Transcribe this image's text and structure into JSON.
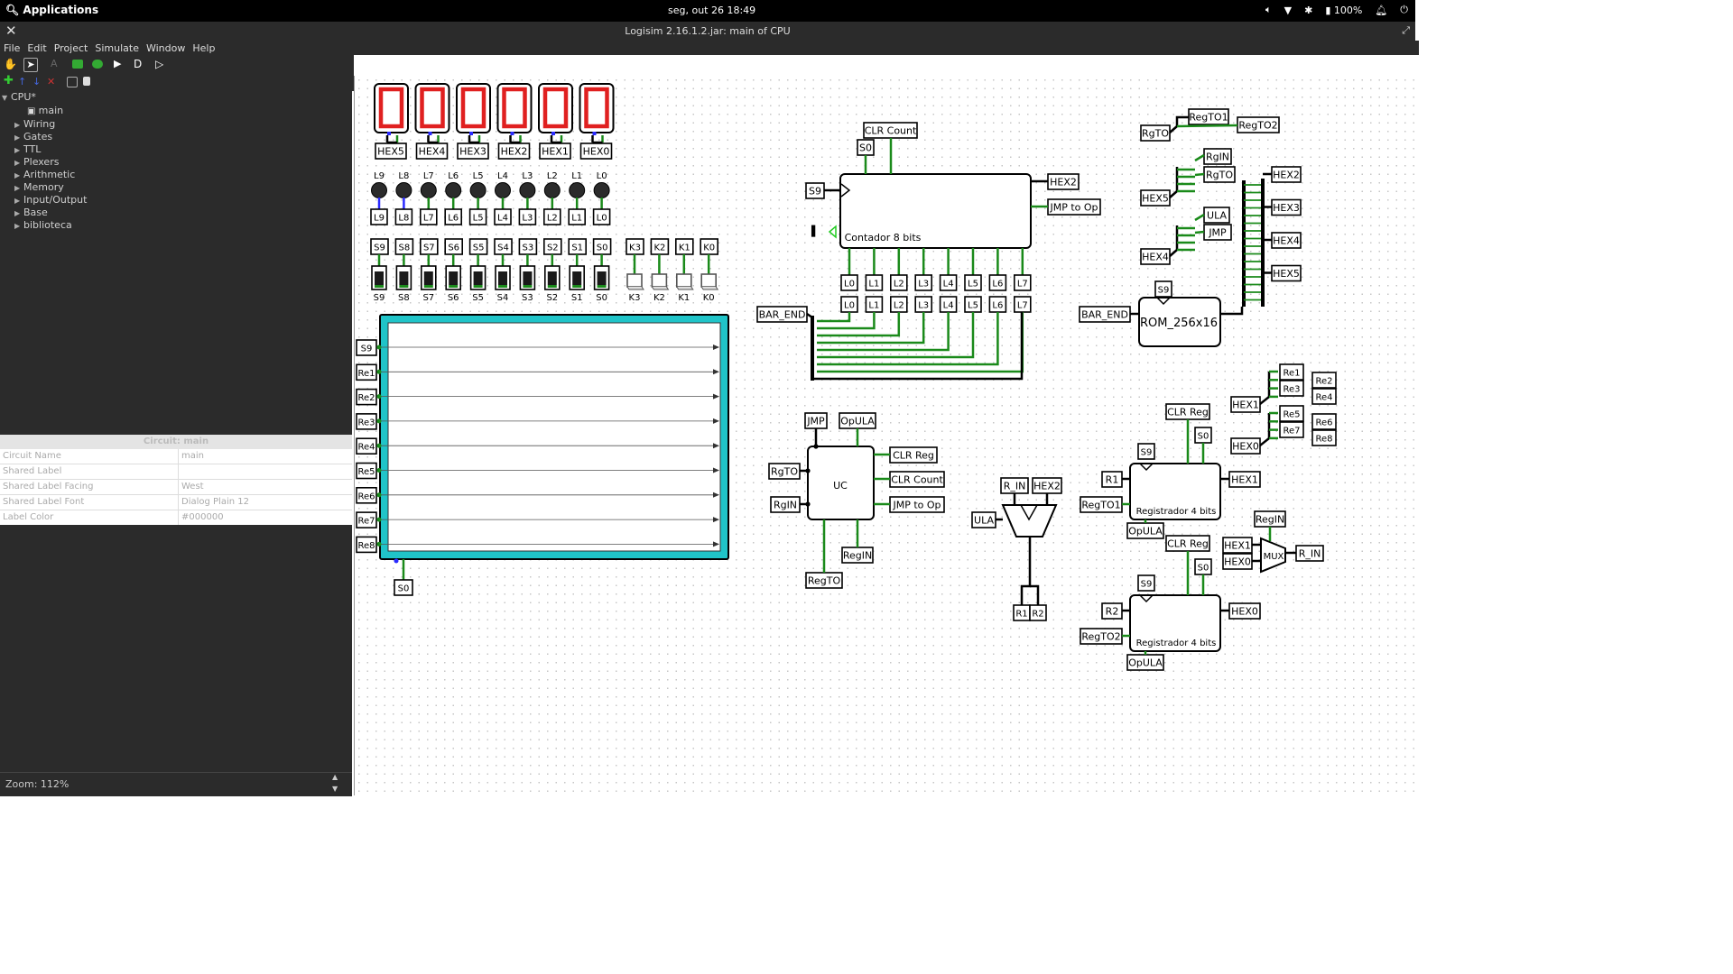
{
  "topbar": {
    "applications": "Applications",
    "datetime": "seg, out 26   18:49",
    "battery": "100%"
  },
  "window": {
    "title": "Logisim 2.16.1.2.jar: main of CPU"
  },
  "menu": [
    "File",
    "Edit",
    "Project",
    "Simulate",
    "Window",
    "Help"
  ],
  "tree": {
    "root": "CPU*",
    "main": "main",
    "libraries": [
      "Wiring",
      "Gates",
      "TTL",
      "Plexers",
      "Arithmetic",
      "Memory",
      "Input/Output",
      "Base",
      "biblioteca"
    ]
  },
  "props": {
    "header": "Circuit: main",
    "rows": [
      {
        "k": "Circuit Name",
        "v": "main"
      },
      {
        "k": "Shared Label",
        "v": ""
      },
      {
        "k": "Shared Label Facing",
        "v": "West"
      },
      {
        "k": "Shared Label Font",
        "v": "Dialog Plain 12"
      },
      {
        "k": "Label Color",
        "v": "#000000"
      }
    ]
  },
  "zoom": "Zoom: 112%",
  "circuit": {
    "hex_tunnels": [
      "HEX5",
      "HEX4",
      "HEX3",
      "HEX2",
      "HEX1",
      "HEX0"
    ],
    "leds": [
      "L9",
      "L8",
      "L7",
      "L6",
      "L5",
      "L4",
      "L3",
      "L2",
      "L1",
      "L0"
    ],
    "switches": [
      "S9",
      "S8",
      "S7",
      "S6",
      "S5",
      "S4",
      "S3",
      "S2",
      "S1",
      "S0"
    ],
    "keys": [
      "K3",
      "K2",
      "K1",
      "K0"
    ],
    "panel_inputs": [
      "S9",
      "Re1",
      "Re2",
      "Re3",
      "Re4",
      "Re5",
      "Re6",
      "Re7",
      "Re8"
    ],
    "panel_clock": "S0",
    "counter": {
      "name": "Contador 8 bits",
      "clr": "CLR Count",
      "s0": "S0",
      "clk": "S9",
      "out1": "HEX2",
      "out2": "JMP to Op",
      "bar_end": "BAR_END"
    },
    "counter_bits": [
      "L0",
      "L1",
      "L2",
      "L3",
      "L4",
      "L5",
      "L6",
      "L7"
    ],
    "uc": {
      "name": "UC",
      "in_top": [
        "JMP",
        "OpULA"
      ],
      "in_left": [
        "RgTO",
        "RgIN"
      ],
      "out_right": [
        "CLR Reg",
        "CLR Count",
        "JMP to Op"
      ],
      "out_bottom": [
        "RegTO",
        "RegIN"
      ]
    },
    "alu": {
      "r_in": "R_IN",
      "hex2": "HEX2",
      "ula": "ULA",
      "r1": "R1",
      "r2": "R2"
    },
    "rom": {
      "name": "ROM_256x16",
      "s9": "S9",
      "bar_end": "BAR_END"
    },
    "rom_outputs": [
      "HEX2",
      "HEX3",
      "HEX4",
      "HEX5"
    ],
    "split_top": {
      "rgto": "RgTO",
      "regto1": "RegTO1",
      "regto2": "RegTO2"
    },
    "split_hex5": {
      "hex": "HEX5",
      "a": "RgIN",
      "b": "RgTO"
    },
    "split_hex4": {
      "hex": "HEX4",
      "a": "ULA",
      "b": "JMP"
    },
    "split_hex1": {
      "hex": "HEX1",
      "outs": [
        "Re1",
        "Re2",
        "Re3",
        "Re4"
      ]
    },
    "split_hex0": {
      "hex": "HEX0",
      "outs": [
        "Re5",
        "Re6",
        "Re7",
        "Re8"
      ]
    },
    "reg1": {
      "name": "Registrador 4 bits",
      "clr": "CLR Reg",
      "s0": "S0",
      "s9": "S9",
      "in": "R1",
      "en": "RegTO1",
      "out": "HEX1",
      "op": "OpULA"
    },
    "reg2": {
      "name": "Registrador 4 bits",
      "clr": "CLR Reg",
      "s0": "S0",
      "s9": "S9",
      "in": "R2",
      "en": "RegTO2",
      "out": "HEX0",
      "op": "OpULA"
    },
    "mux": {
      "name": "MUX",
      "sel": "RegIN",
      "a": "HEX1",
      "b": "HEX0",
      "out": "R_IN"
    }
  }
}
